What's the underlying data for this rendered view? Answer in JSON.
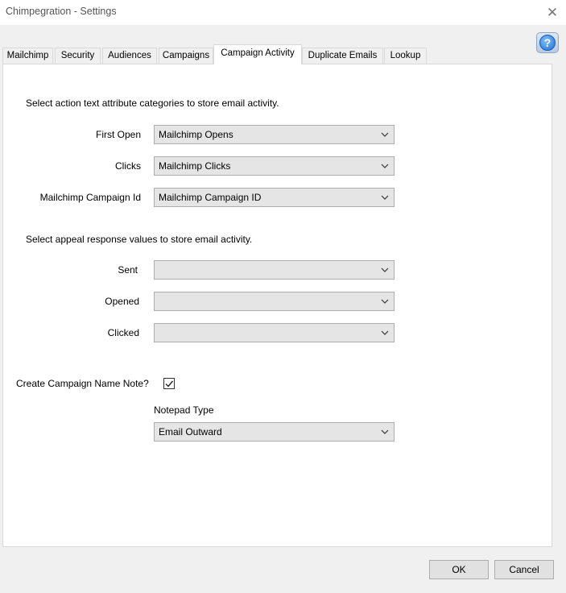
{
  "window": {
    "title": "Chimpegration - Settings",
    "close_glyph": "✕"
  },
  "help": {
    "label": "?"
  },
  "tabs": [
    {
      "label": "Mailchimp"
    },
    {
      "label": "Security"
    },
    {
      "label": "Audiences"
    },
    {
      "label": "Campaigns"
    },
    {
      "label": "Campaign Activity",
      "active": true
    },
    {
      "label": "Duplicate Emails"
    },
    {
      "label": "Lookup"
    }
  ],
  "action_section": {
    "heading": "Select action text attribute categories to store email activity.",
    "fields": [
      {
        "label": "First Open",
        "value": "Mailchimp Opens"
      },
      {
        "label": "Clicks",
        "value": "Mailchimp Clicks"
      },
      {
        "label": "Mailchimp Campaign Id",
        "value": "Mailchimp Campaign ID"
      }
    ]
  },
  "appeal_section": {
    "heading": "Select appeal response values to store email activity.",
    "fields": [
      {
        "label": "Sent",
        "value": ""
      },
      {
        "label": "Opened",
        "value": ""
      },
      {
        "label": "Clicked",
        "value": ""
      }
    ]
  },
  "note": {
    "label": "Create Campaign Name Note?",
    "checked": true,
    "notepad_label": "Notepad Type",
    "notepad_value": "Email Outward"
  },
  "buttons": {
    "ok": "OK",
    "cancel": "Cancel"
  }
}
